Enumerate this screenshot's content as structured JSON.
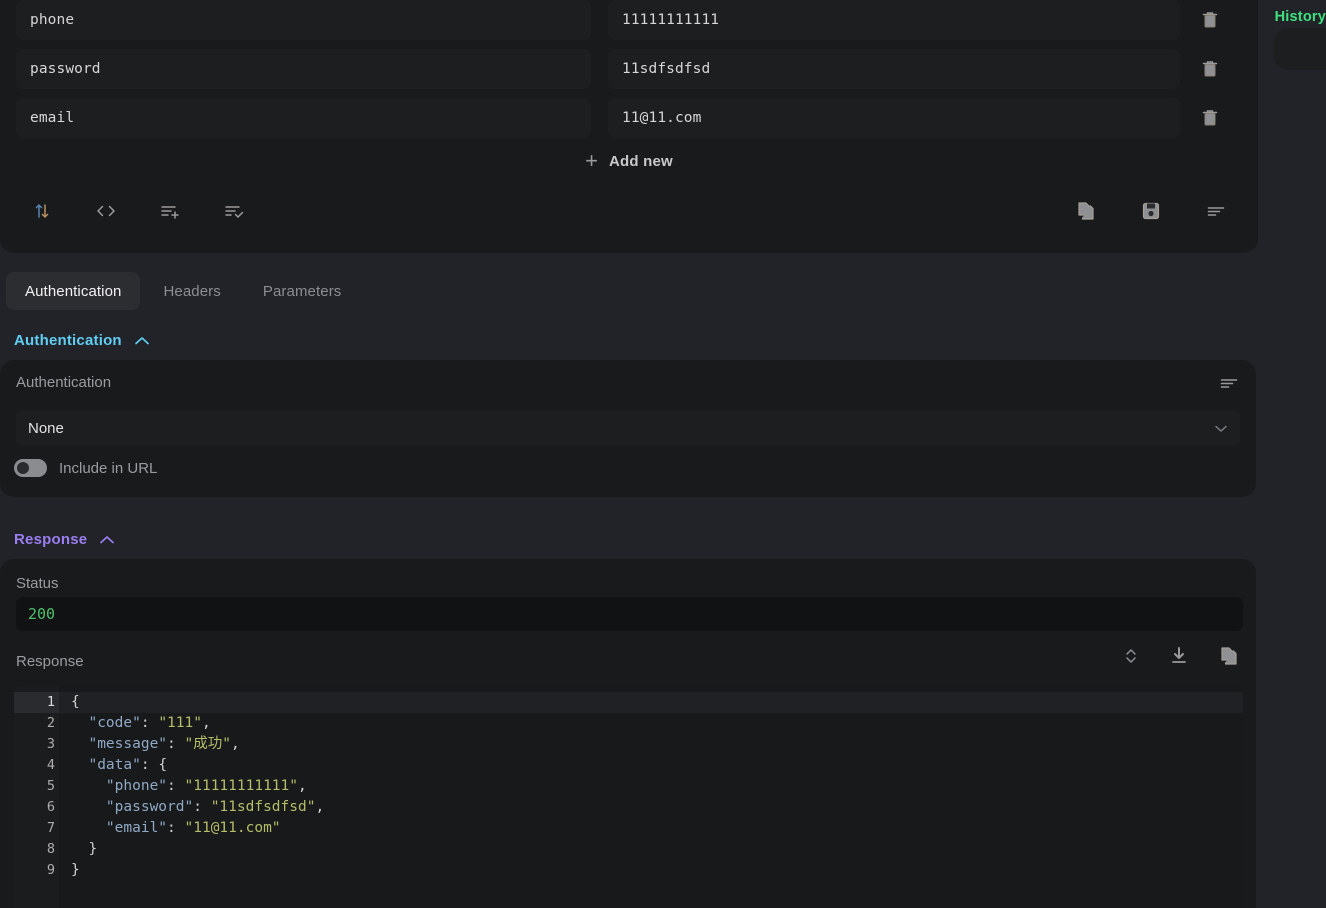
{
  "kv_editor": {
    "rows": [
      {
        "key": "phone",
        "value": "11111111111",
        "delete_icon": "trash-icon"
      },
      {
        "key": "password",
        "value": "11sdfsdfsd",
        "delete_icon": "trash-icon"
      },
      {
        "key": "email",
        "value": "11@11.com",
        "delete_icon": "trash-icon"
      }
    ],
    "add_new": {
      "plus": "+",
      "label": "Add new"
    },
    "toolbar_left": [
      {
        "name": "sort-icon",
        "title": "Sort"
      },
      {
        "name": "code-icon",
        "title": "Code view"
      },
      {
        "name": "list-plus-icon",
        "title": "Add row"
      },
      {
        "name": "list-check-icon",
        "title": "Check all"
      }
    ],
    "toolbar_right": [
      {
        "name": "copy-icon",
        "title": "Copy"
      },
      {
        "name": "save-icon",
        "title": "Save"
      },
      {
        "name": "align-icon",
        "title": "Menu"
      }
    ]
  },
  "history": {
    "label": "History"
  },
  "tabs": [
    {
      "label": "Authentication",
      "active": true
    },
    {
      "label": "Headers",
      "active": false
    },
    {
      "label": "Parameters",
      "active": false
    }
  ],
  "auth_section": {
    "heading": "Authentication",
    "collapse_icon": "chevron-up-icon",
    "field_label": "Authentication",
    "menu_icon": "align-icon",
    "selected": "None",
    "options": [
      "None"
    ],
    "dropdown_icon": "chevron-down-icon",
    "toggle": {
      "label": "Include in URL",
      "on": false
    }
  },
  "response_section": {
    "heading": "Response",
    "collapse_icon": "chevron-up-icon",
    "status_label": "Status",
    "status_code": "200",
    "body_label": "Response",
    "tools": [
      {
        "name": "expand-collapse-icon",
        "title": "Expand / collapse"
      },
      {
        "name": "download-icon",
        "title": "Download"
      },
      {
        "name": "copy-icon",
        "title": "Copy"
      }
    ],
    "editor": {
      "line_numbers": [
        "1",
        "2",
        "3",
        "4",
        "5",
        "6",
        "7",
        "8",
        "9"
      ],
      "fold_lines": [
        1,
        4
      ],
      "active_line": 1,
      "lines": [
        [
          {
            "t": "{",
            "c": "p"
          }
        ],
        [
          {
            "t": "  ",
            "c": "p"
          },
          {
            "t": "\"code\"",
            "c": "k"
          },
          {
            "t": ": ",
            "c": "p"
          },
          {
            "t": "\"111\"",
            "c": "s"
          },
          {
            "t": ",",
            "c": "p"
          }
        ],
        [
          {
            "t": "  ",
            "c": "p"
          },
          {
            "t": "\"message\"",
            "c": "k"
          },
          {
            "t": ": ",
            "c": "p"
          },
          {
            "t": "\"成功\"",
            "c": "s"
          },
          {
            "t": ",",
            "c": "p"
          }
        ],
        [
          {
            "t": "  ",
            "c": "p"
          },
          {
            "t": "\"data\"",
            "c": "k"
          },
          {
            "t": ": {",
            "c": "p"
          }
        ],
        [
          {
            "t": "    ",
            "c": "p"
          },
          {
            "t": "\"phone\"",
            "c": "k"
          },
          {
            "t": ": ",
            "c": "p"
          },
          {
            "t": "\"11111111111\"",
            "c": "s"
          },
          {
            "t": ",",
            "c": "p"
          }
        ],
        [
          {
            "t": "    ",
            "c": "p"
          },
          {
            "t": "\"password\"",
            "c": "k"
          },
          {
            "t": ": ",
            "c": "p"
          },
          {
            "t": "\"11sdfsdfsd\"",
            "c": "s"
          },
          {
            "t": ",",
            "c": "p"
          }
        ],
        [
          {
            "t": "    ",
            "c": "p"
          },
          {
            "t": "\"email\"",
            "c": "k"
          },
          {
            "t": ": ",
            "c": "p"
          },
          {
            "t": "\"11@11.com\"",
            "c": "s"
          }
        ],
        [
          {
            "t": "  }",
            "c": "p"
          }
        ],
        [
          {
            "t": "}",
            "c": "p"
          }
        ]
      ]
    }
  },
  "colors": {
    "page_bg": "#212328",
    "panel_bg": "#191a1c",
    "field_bg": "#1d1e20",
    "auth_accent": "#60cdf2",
    "response_accent": "#9b7ef0",
    "history_accent": "#3ee07f",
    "status_green": "#4ec26a",
    "json_key": "#8fa8c4",
    "json_string": "#b5bd68"
  }
}
